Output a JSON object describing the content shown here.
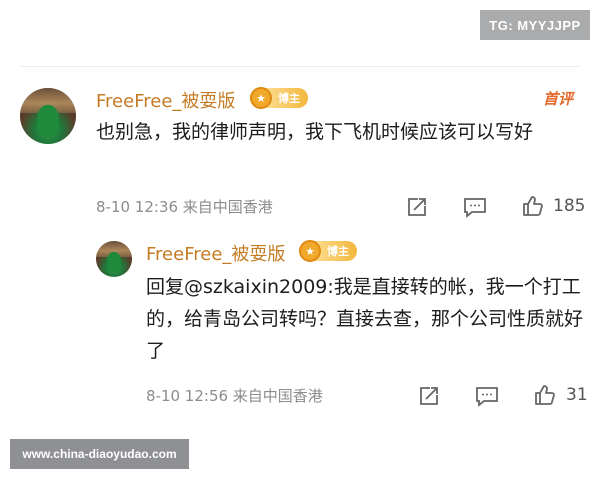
{
  "watermarks": {
    "top_right": "TG: MYYJJPP",
    "bottom_left": "www.china-diaoyudao.com"
  },
  "comment": {
    "username": "FreeFree_被耍版",
    "badge": "博主",
    "tag": "首评",
    "text": "也别急，我的律师声明，我下飞机时候应该可以写好",
    "meta": "8-10 12:36 来自中国香港",
    "likes": "185"
  },
  "reply": {
    "username": "FreeFree_被耍版",
    "badge": "博主",
    "text": "回复@szkaixin2009:我是直接转的帐，我一个打工的，给青岛公司转吗？直接去查，那个公司性质就好了",
    "meta": "8-10 12:56 来自中国香港",
    "likes": "31"
  },
  "icons": [
    "share-icon",
    "comment-icon",
    "like-icon"
  ],
  "colors": {
    "username": "#c57b23",
    "first_tag": "#e26a2c",
    "badge": "#f3b73c"
  }
}
